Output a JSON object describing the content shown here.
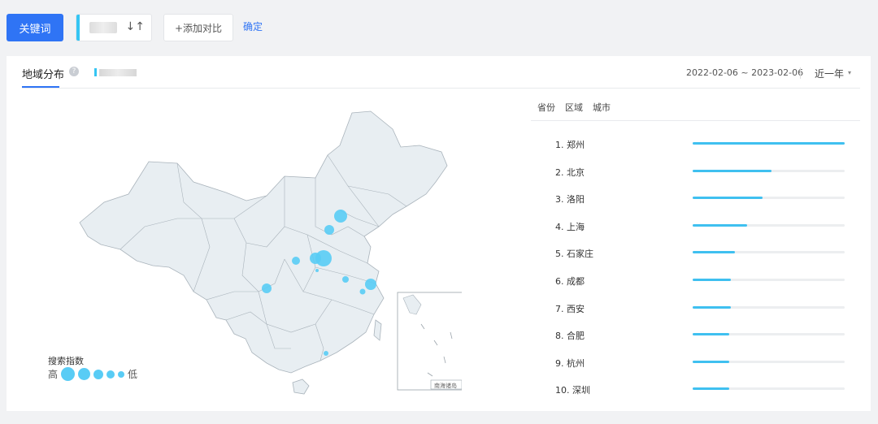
{
  "toolbar": {
    "keyword_button": "关键词",
    "sort_icon": "↓↑",
    "add_compare": "+添加对比",
    "confirm": "确定"
  },
  "panel": {
    "tab_title": "地域分布",
    "help_icon": "?",
    "date_range": "2022-02-06 ~ 2023-02-06",
    "period": "近一年",
    "caret": "▾"
  },
  "map": {
    "legend_title": "搜索指数",
    "legend_high": "高",
    "legend_low": "低",
    "inset_label": "南海诸岛"
  },
  "ranking": {
    "tabs": [
      "省份",
      "区域",
      "城市"
    ],
    "items": [
      {
        "label": "1.  郑州",
        "value": 100
      },
      {
        "label": "2.  北京",
        "value": 52
      },
      {
        "label": "3.  洛阳",
        "value": 46
      },
      {
        "label": "4.  上海",
        "value": 36
      },
      {
        "label": "5.  石家庄",
        "value": 28
      },
      {
        "label": "6.  成都",
        "value": 25
      },
      {
        "label": "7.  西安",
        "value": 25
      },
      {
        "label": "8.  合肥",
        "value": 24
      },
      {
        "label": "9.  杭州",
        "value": 24
      },
      {
        "label": "10. 深圳",
        "value": 24
      }
    ]
  },
  "colors": {
    "accent_blue": "#2f74f5",
    "bar_blue": "#3fc0f0",
    "bubble": "#59ccf5",
    "map_fill": "#e8eef2"
  }
}
